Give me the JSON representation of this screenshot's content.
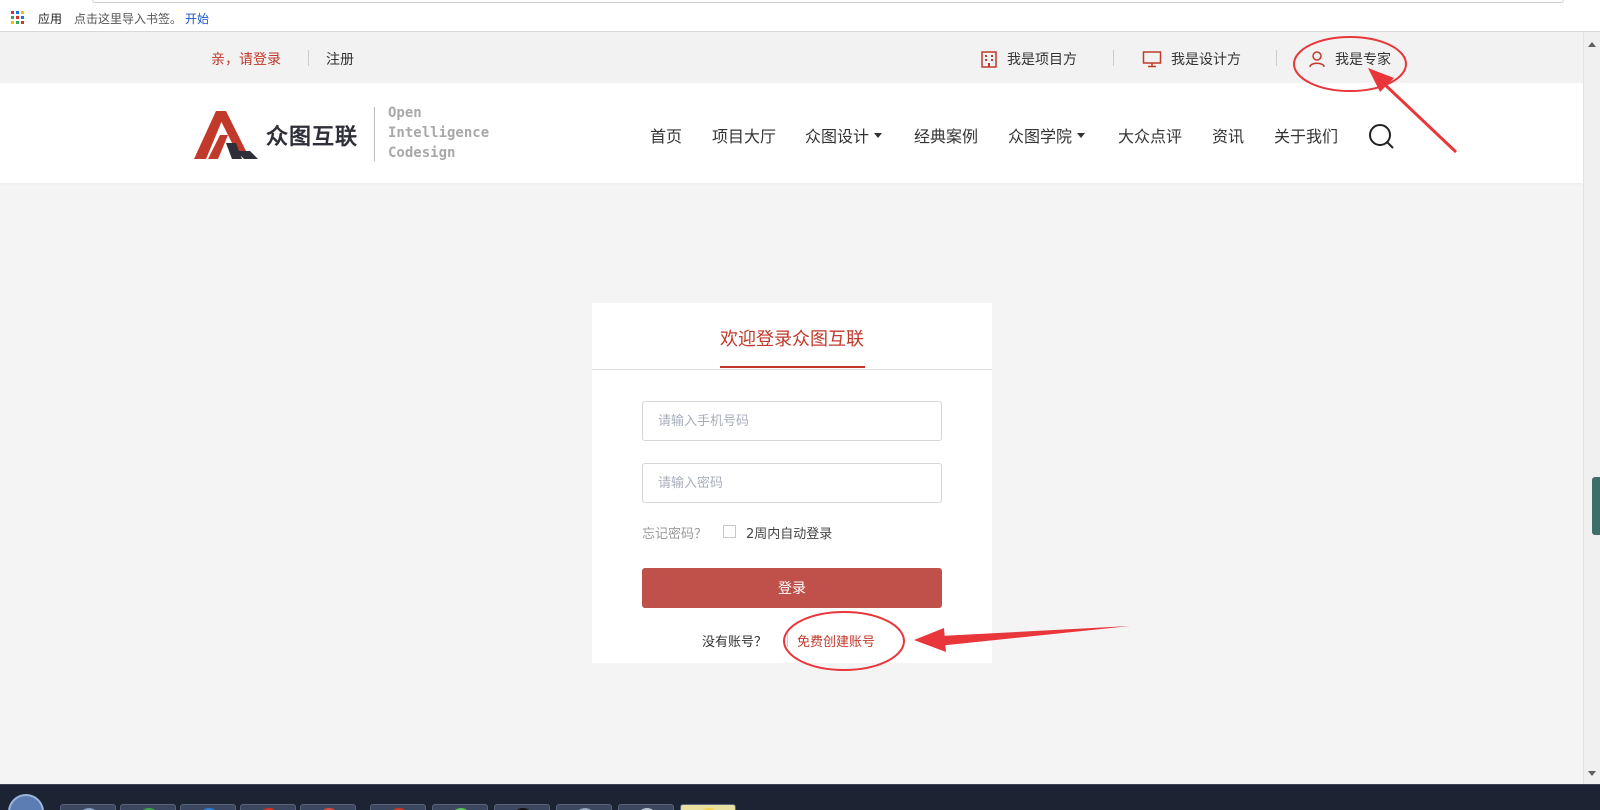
{
  "browser": {
    "bookmarks": {
      "apps_label": "应用",
      "hint": "点击这里导入书签。",
      "start_link": "开始"
    }
  },
  "utility_bar": {
    "login_prompt": "亲，请登录",
    "register": "注册",
    "roles": [
      {
        "label": "我是项目方",
        "icon": "building-icon"
      },
      {
        "label": "我是设计方",
        "icon": "monitor-icon"
      },
      {
        "label": "我是专家",
        "icon": "user-icon"
      }
    ]
  },
  "header": {
    "logo": {
      "name": "众图互联",
      "tagline": [
        "Open",
        "Intelligence",
        "Codesign"
      ]
    },
    "nav": [
      {
        "label": "首页",
        "dropdown": false
      },
      {
        "label": "项目大厅",
        "dropdown": false
      },
      {
        "label": "众图设计",
        "dropdown": true
      },
      {
        "label": "经典案例",
        "dropdown": false
      },
      {
        "label": "众图学院",
        "dropdown": true
      },
      {
        "label": "大众点评",
        "dropdown": false
      },
      {
        "label": "资讯",
        "dropdown": false
      },
      {
        "label": "关于我们",
        "dropdown": false
      }
    ]
  },
  "login_card": {
    "title": "欢迎登录众图互联",
    "phone_placeholder": "请输入手机号码",
    "password_placeholder": "请输入密码",
    "forgot_password": "忘记密码？",
    "remember_label": "2周内自动登录",
    "remember_checked": false,
    "submit_label": "登录",
    "no_account": "没有账号？",
    "create_account": "免费创建账号"
  },
  "colors": {
    "brand_red": "#c0392b",
    "button_red": "#c0504a",
    "annotation_red": "#e8363a"
  }
}
